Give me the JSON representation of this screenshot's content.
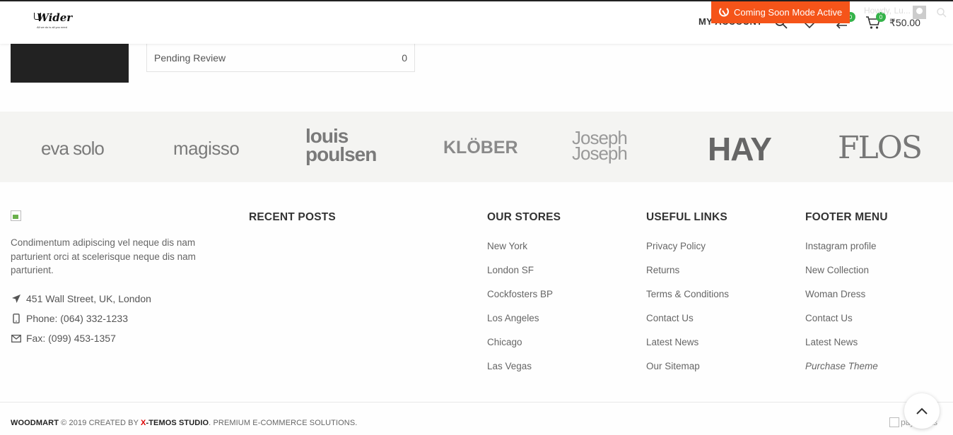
{
  "header": {
    "logo_text": "Wider",
    "logo_tagline": "All we do is all you need",
    "account_label": "MY ACCOUNT",
    "compare_count": "0",
    "cart_count": "0",
    "cart_total": "₹50.00",
    "coming_soon": "Coming Soon Mode Active",
    "user_hint": "Howdy, Lu..."
  },
  "account_summary": {
    "pending_label": "Pending Review",
    "pending_value": "0"
  },
  "brands": [
    "eva solo",
    "magisso",
    "louis poulsen",
    "KLÖBER",
    "Joseph Joseph",
    "HAY",
    "FLOS"
  ],
  "footer": {
    "description": "Condimentum adipiscing vel neque dis nam parturient orci at scelerisque neque dis nam parturient.",
    "address": "451 Wall Street, UK, London",
    "phone": "Phone: (064) 332-1233",
    "fax": "Fax: (099) 453-1357",
    "recent_posts_title": "RECENT POSTS",
    "stores": {
      "title": "OUR STORES",
      "items": [
        "New York",
        "London SF",
        "Cockfosters BP",
        "Los Angeles",
        "Chicago",
        "Las Vegas"
      ]
    },
    "useful": {
      "title": "USEFUL LINKS",
      "items": [
        "Privacy Policy",
        "Returns",
        "Terms & Conditions",
        "Contact Us",
        "Latest News",
        "Our Sitemap"
      ]
    },
    "menu": {
      "title": "FOOTER MENU",
      "items": [
        "Instagram profile",
        "New Collection",
        "Woman Dress",
        "Contact Us",
        "Latest News",
        "Purchase Theme"
      ]
    }
  },
  "copyright": {
    "brand": "WOODMART",
    "symbol": "©",
    "text1": " 2019 CREATED BY ",
    "x": "X",
    "studio": "-TEMOS STUDIO",
    "text2": ". PREMIUM E-COMMERCE SOLUTIONS."
  },
  "payments_alt": "payments",
  "colors": {
    "accent": "#f55419",
    "badge": "#35b34a",
    "brand_strip": "#f4f4f2"
  }
}
